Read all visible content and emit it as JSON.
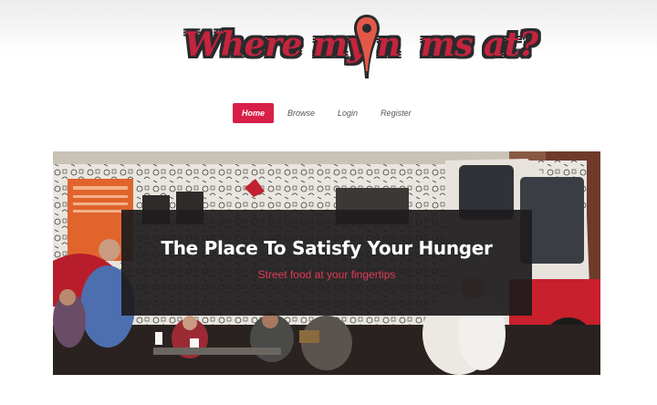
{
  "logo": {
    "text_before": "Where my n",
    "text_after": "ms at?",
    "icon": "map-pin-icon",
    "colors": {
      "fill": "#c4243e",
      "outline": "#2a2a2d",
      "pin": "#e4584a"
    }
  },
  "nav": {
    "items": [
      {
        "label": "Home",
        "active": true
      },
      {
        "label": "Browse",
        "active": false
      },
      {
        "label": "Login",
        "active": false
      },
      {
        "label": "Register",
        "active": false
      }
    ],
    "active_color": "#d81f48"
  },
  "hero": {
    "title": "The Place To Satisfy Your Hunger",
    "subtitle": "Street food at your fingertips",
    "subtitle_color": "#e23a59"
  }
}
